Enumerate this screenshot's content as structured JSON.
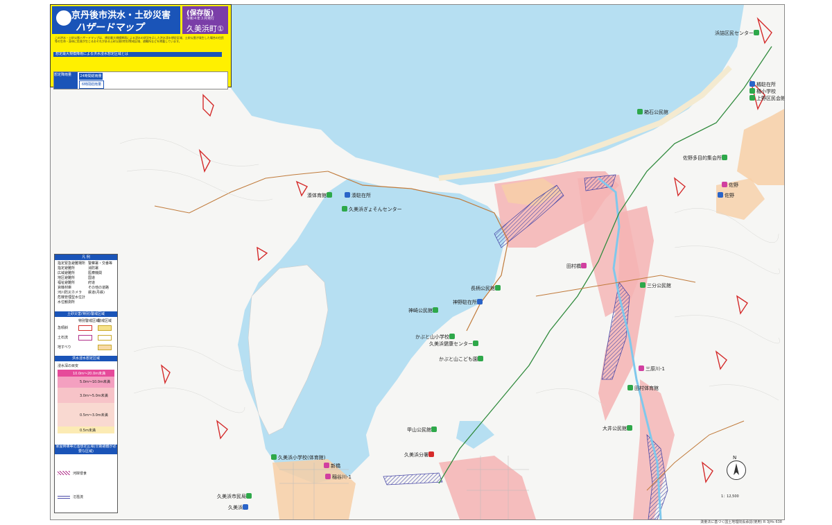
{
  "title": {
    "city": "京丹後市洪水・土砂災害",
    "subtitle": "ハザードマップ",
    "edition": "(保存版)",
    "date": "令和４年３月発行",
    "area": "久美浜町①",
    "description": "この洪水・土砂災害ハザードマップは、想定最大規模降雨による浸水の状況を示した洪水浸水想定区域、土砂災害が発生した場合の住民等の生命・身体に危害が生じるおそれがある土砂災害(特別)警戒区域、避難所などを掲載しています。",
    "assumption_header": "想定最大規模降雨による洪水浸水想定区域とは",
    "rain_table_label": "想定降雨量",
    "rain_row1": "24時間総雨量",
    "rain_row2": "6時間総雨量"
  },
  "legend": {
    "header": "凡 例",
    "items_left": [
      "指定緊急避難場所",
      "指定避難所",
      "広域避難所",
      "地区避難所",
      "福祉避難所",
      "資機材庫",
      "河川防災カメラ",
      "危機管理型水位計",
      "水位観測所"
    ],
    "items_right": [
      "警察署・交番等",
      "消防署",
      "医療機関",
      "国道",
      "府道",
      "その他の道路",
      "鉄道(丹鉄)"
    ],
    "landslide_header": "土砂災害(特別)警戒区域",
    "landslide_cols": [
      "特別警戒区域",
      "警戒区域"
    ],
    "landslide_rows": [
      "急傾斜",
      "土石流",
      "地すべり"
    ],
    "flood_header": "洪水浸水想定区域",
    "depth_label": "浸水深の目安",
    "depths": [
      "10.0m〜20.0m未満",
      "5.0m〜10.0m未満",
      "3.0m〜5.0m未満",
      "0.5m〜3.0m未満",
      "0.5m未満"
    ],
    "house_header": "家屋倒壊等氾濫想定区域(早期避難が必要な区域)",
    "bank_erosion": "河岸侵食",
    "flood_overflow": "氾濫流"
  },
  "places": [
    {
      "name": "浜詰区民センター",
      "icon": "green"
    },
    {
      "name": "橘駐在所",
      "icon": "blue"
    },
    {
      "name": "橘小学校",
      "icon": "green"
    },
    {
      "name": "上野区民会館",
      "icon": "green"
    },
    {
      "name": "箱石公民館",
      "icon": "green"
    },
    {
      "name": "佐野多目的集会所",
      "icon": "green"
    },
    {
      "name": "湊体育館",
      "icon": "green"
    },
    {
      "name": "湊駐在所",
      "icon": "blue"
    },
    {
      "name": "久美浜ぎょそんセンター",
      "icon": "green"
    },
    {
      "name": "佐野",
      "icon": "pink"
    },
    {
      "name": "佐野",
      "icon": "blue"
    },
    {
      "name": "田村橋",
      "icon": "pink"
    },
    {
      "name": "三分公民館",
      "icon": "green"
    },
    {
      "name": "長柄公民館",
      "icon": "green"
    },
    {
      "name": "神野駐在所",
      "icon": "blue"
    },
    {
      "name": "神崎公民館",
      "icon": "green"
    },
    {
      "name": "かぶと山小学校",
      "icon": "green"
    },
    {
      "name": "久美浜健康センター",
      "icon": "green"
    },
    {
      "name": "かぶと山こども園",
      "icon": "green"
    },
    {
      "name": "三原川-1",
      "icon": "pink"
    },
    {
      "name": "田村体育館",
      "icon": "green"
    },
    {
      "name": "大井公民館",
      "icon": "green"
    },
    {
      "name": "甲山公民館",
      "icon": "green"
    },
    {
      "name": "久美浜分署",
      "icon": "red"
    },
    {
      "name": "久美浜小学校(体育館)",
      "icon": "green"
    },
    {
      "name": "新橋",
      "icon": "pink"
    },
    {
      "name": "稲谷川-1",
      "icon": "pink"
    },
    {
      "name": "久美浜市民局",
      "icon": "green"
    },
    {
      "name": "久美浜",
      "icon": "blue"
    }
  ],
  "scale": "1：12,500",
  "north": "N",
  "credit": "測量法に基づく国土地理院長承認(使用) R 3JHs 638",
  "colors": {
    "sea": "#b6dff2",
    "land": "#f6f6f4",
    "flood_pink": "#f5b3b3",
    "flood_orange": "#f7cfa6",
    "road_green": "#2f8a3c",
    "road_brown": "#c07a3a",
    "title_yellow": "#fff000",
    "title_blue": "#1a54b8",
    "badge_purple": "#7a3ea8"
  }
}
